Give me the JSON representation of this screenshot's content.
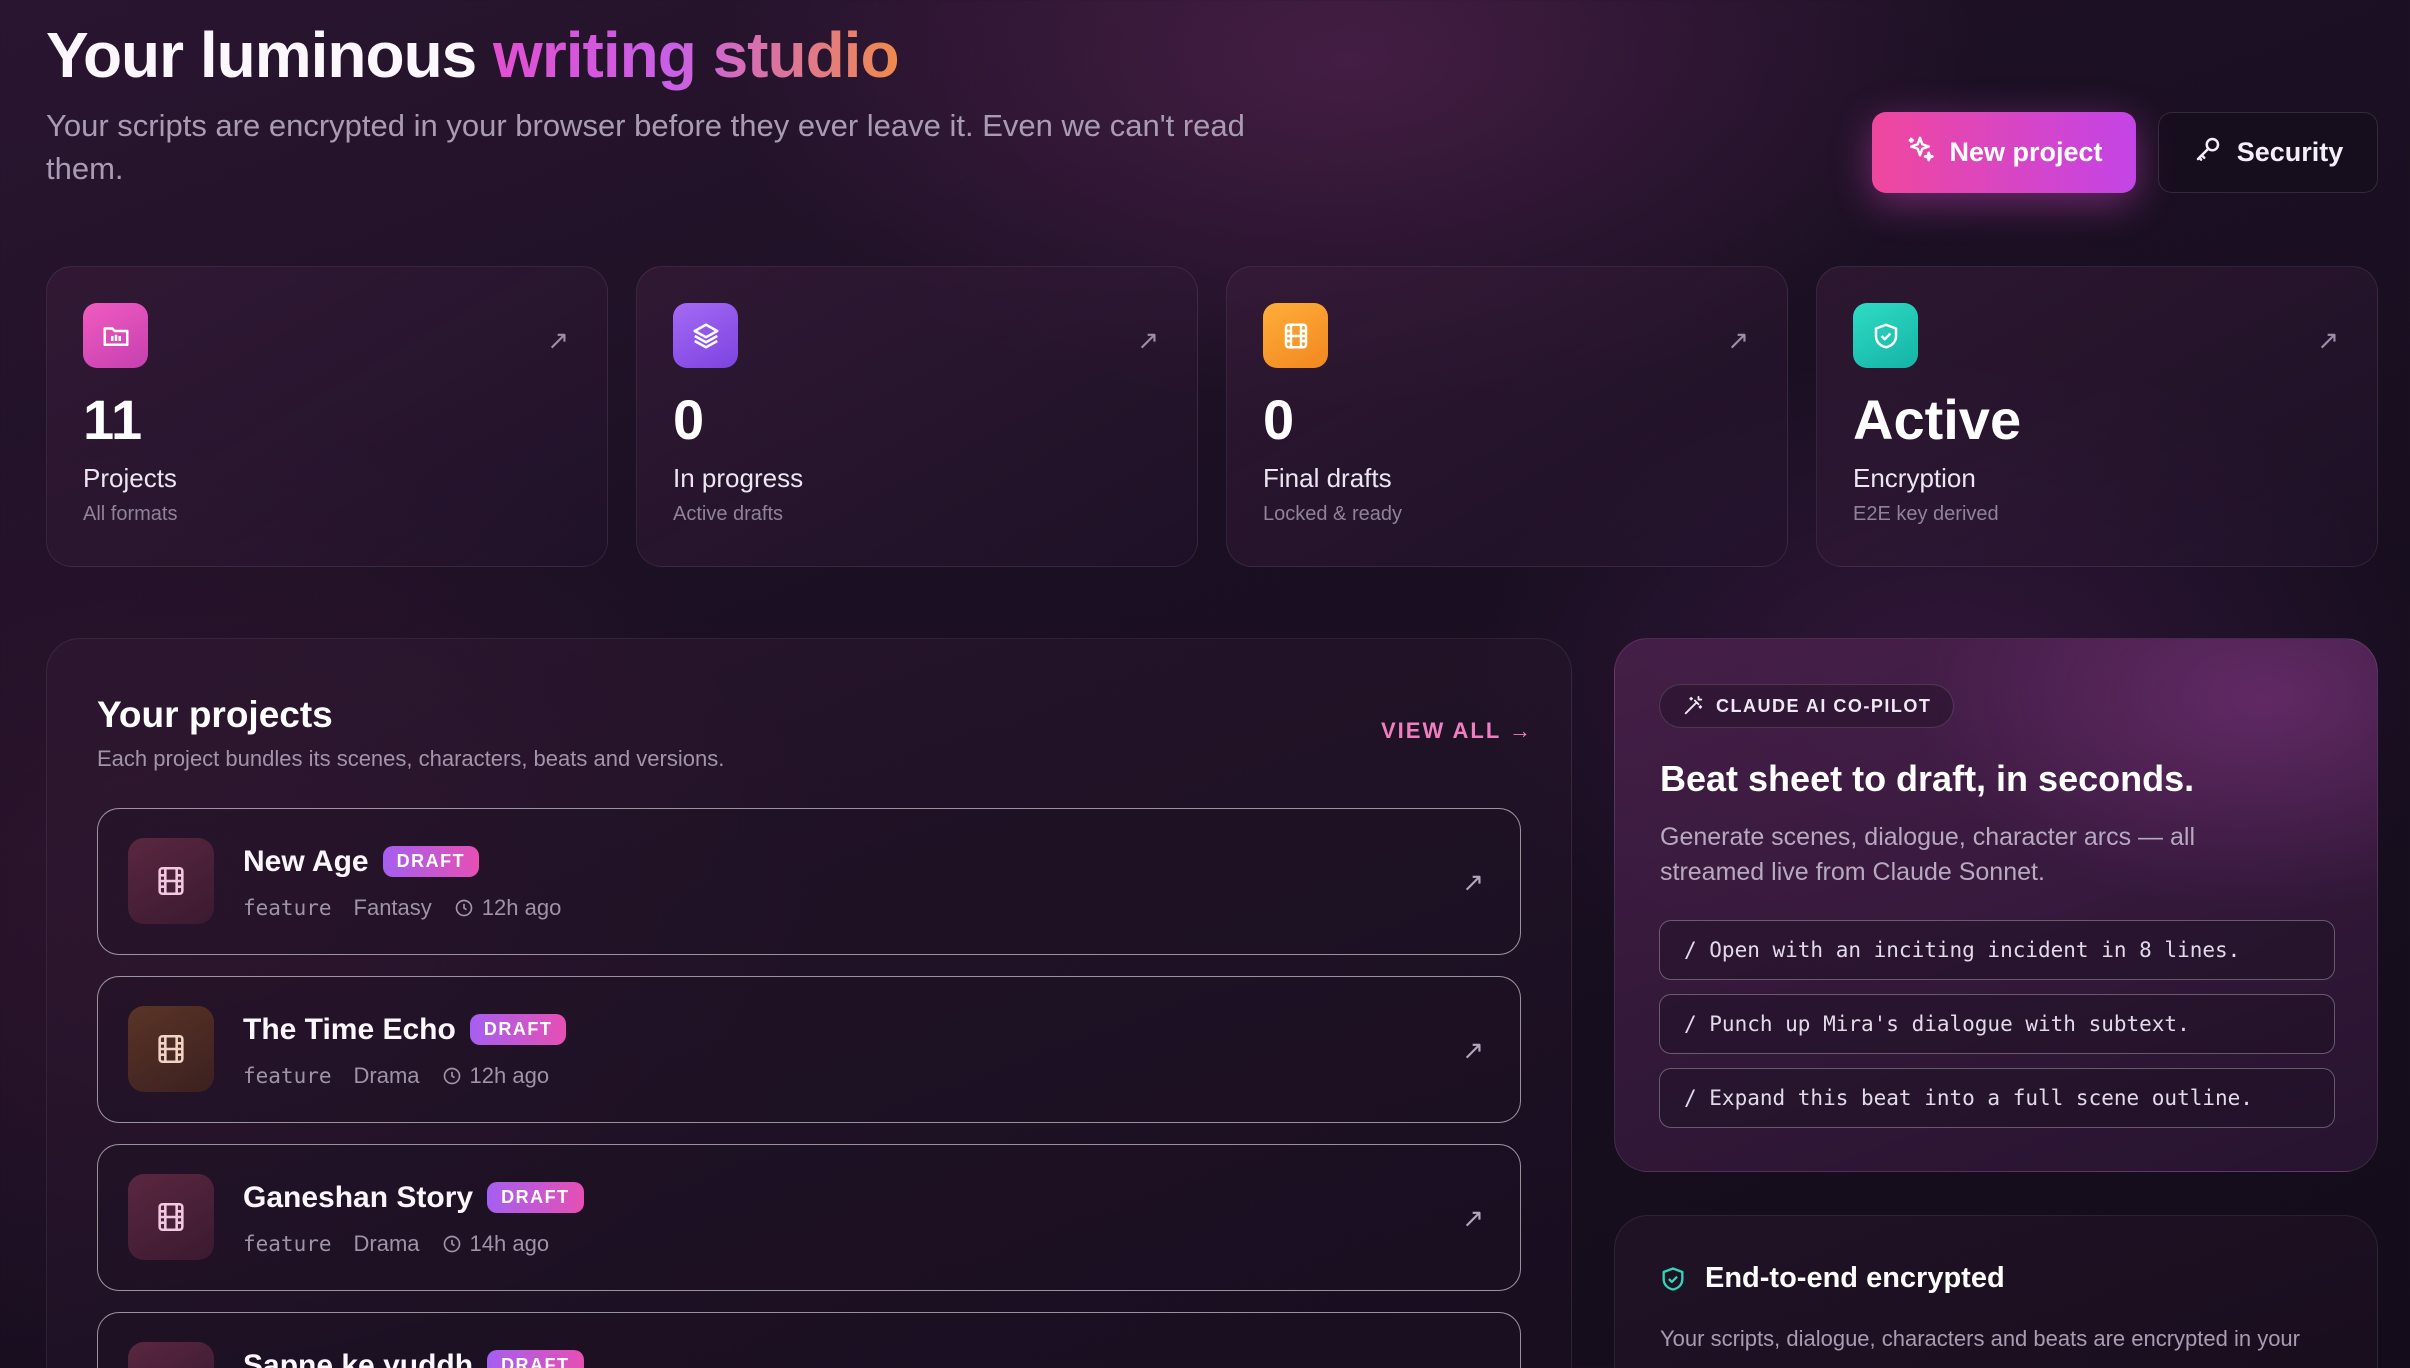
{
  "header": {
    "title_plain": "Your luminous",
    "title_gradient": "writing studio",
    "subtitle": "Your scripts are encrypted in your browser before they ever leave it. Even we can't read them.",
    "new_project_label": "New project",
    "security_label": "Security"
  },
  "stats": [
    {
      "value": "11",
      "label": "Projects",
      "sub": "All formats",
      "icon": "folder-icon",
      "color": "#e74fb6"
    },
    {
      "value": "0",
      "label": "In progress",
      "sub": "Active drafts",
      "icon": "layers-icon",
      "color": "#9b5cf0"
    },
    {
      "value": "0",
      "label": "Final drafts",
      "sub": "Locked & ready",
      "icon": "film-icon",
      "color": "#f59a2b"
    },
    {
      "value": "Active",
      "label": "Encryption",
      "sub": "E2E key derived",
      "icon": "shield-icon",
      "color": "#22c9b6"
    }
  ],
  "projects": {
    "title": "Your projects",
    "description": "Each project bundles its scenes, characters, beats and versions.",
    "view_all": "VIEW ALL →",
    "items": [
      {
        "name": "New Age",
        "badge": "DRAFT",
        "format": "feature",
        "genre": "Fantasy",
        "updated": "12h ago"
      },
      {
        "name": "The Time Echo",
        "badge": "DRAFT",
        "format": "feature",
        "genre": "Drama",
        "updated": "12h ago"
      },
      {
        "name": "Ganeshan Story",
        "badge": "DRAFT",
        "format": "feature",
        "genre": "Drama",
        "updated": "14h ago"
      },
      {
        "name": "Sapne ke yuddh",
        "badge": "DRAFT",
        "format": "",
        "genre": "",
        "updated": ""
      }
    ]
  },
  "copilot": {
    "chip": "CLAUDE AI CO-PILOT",
    "title": "Beat sheet to draft, in seconds.",
    "description": "Generate scenes, dialogue, character arcs — all streamed live from Claude Sonnet.",
    "prompts": [
      "/ Open with an inciting incident in 8 lines.",
      "/ Punch up Mira's dialogue with subtext.",
      "/ Expand this beat into a full scene outline."
    ]
  },
  "security_card": {
    "title": "End-to-end encrypted",
    "description": "Your scripts, dialogue, characters and beats are encrypted in your"
  }
}
